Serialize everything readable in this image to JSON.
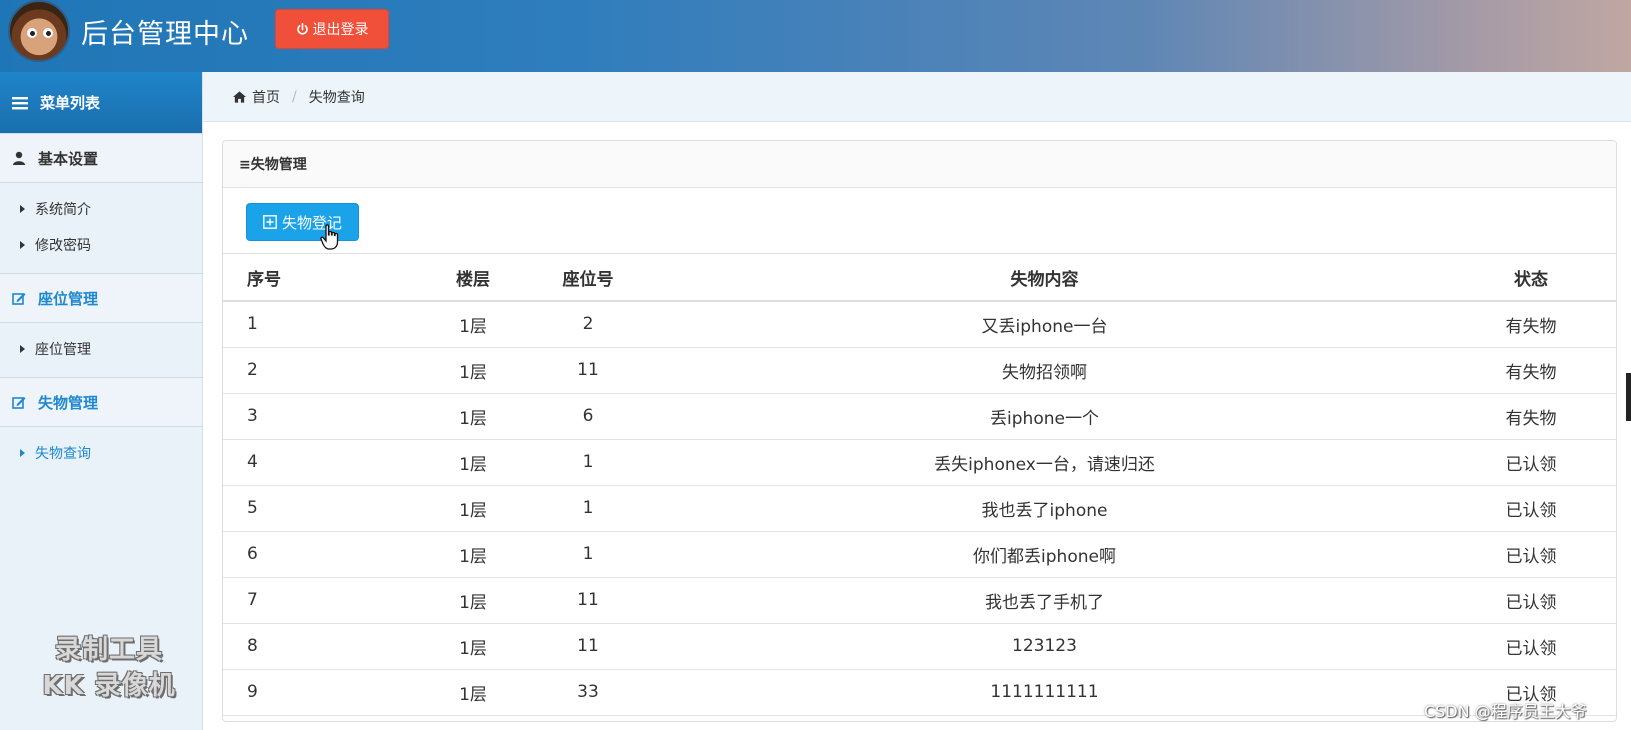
{
  "header": {
    "title": "后台管理中心",
    "logout_label": "退出登录"
  },
  "sidebar": {
    "menu_title": "菜单列表",
    "sections": [
      {
        "title": "基本设置",
        "items": [
          "系统简介",
          "修改密码"
        ]
      },
      {
        "title": "座位管理",
        "items": [
          "座位管理"
        ]
      },
      {
        "title": "失物管理",
        "items": [
          "失物查询"
        ]
      }
    ]
  },
  "breadcrumb": {
    "home": "首页",
    "current": "失物查询"
  },
  "panel": {
    "title": "≡失物管理",
    "add_button": "失物登记"
  },
  "table": {
    "headers": [
      "序号",
      "楼层",
      "座位号",
      "失物内容",
      "状态"
    ],
    "rows": [
      [
        "1",
        "1层",
        "2",
        "又丢iphone一台",
        "有失物"
      ],
      [
        "2",
        "1层",
        "11",
        "失物招领啊",
        "有失物"
      ],
      [
        "3",
        "1层",
        "6",
        "丢iphone一个",
        "有失物"
      ],
      [
        "4",
        "1层",
        "1",
        "丢失iphonex一台，请速归还",
        "已认领"
      ],
      [
        "5",
        "1层",
        "1",
        "我也丢了iphone",
        "已认领"
      ],
      [
        "6",
        "1层",
        "1",
        "你们都丢iphone啊",
        "已认领"
      ],
      [
        "7",
        "1层",
        "11",
        "我也丢了手机了",
        "已认领"
      ],
      [
        "8",
        "1层",
        "11",
        "123123",
        "已认领"
      ],
      [
        "9",
        "1层",
        "33",
        "1111111111",
        "已认领"
      ]
    ]
  },
  "overlay": {
    "recorder_line1": "录制工具",
    "recorder_line2": "KK 录像机",
    "csdn": "CSDN @程序员王大爷"
  },
  "colors": {
    "accent": "#1aa3e8",
    "danger": "#f0503a",
    "link": "#1f88cf"
  }
}
